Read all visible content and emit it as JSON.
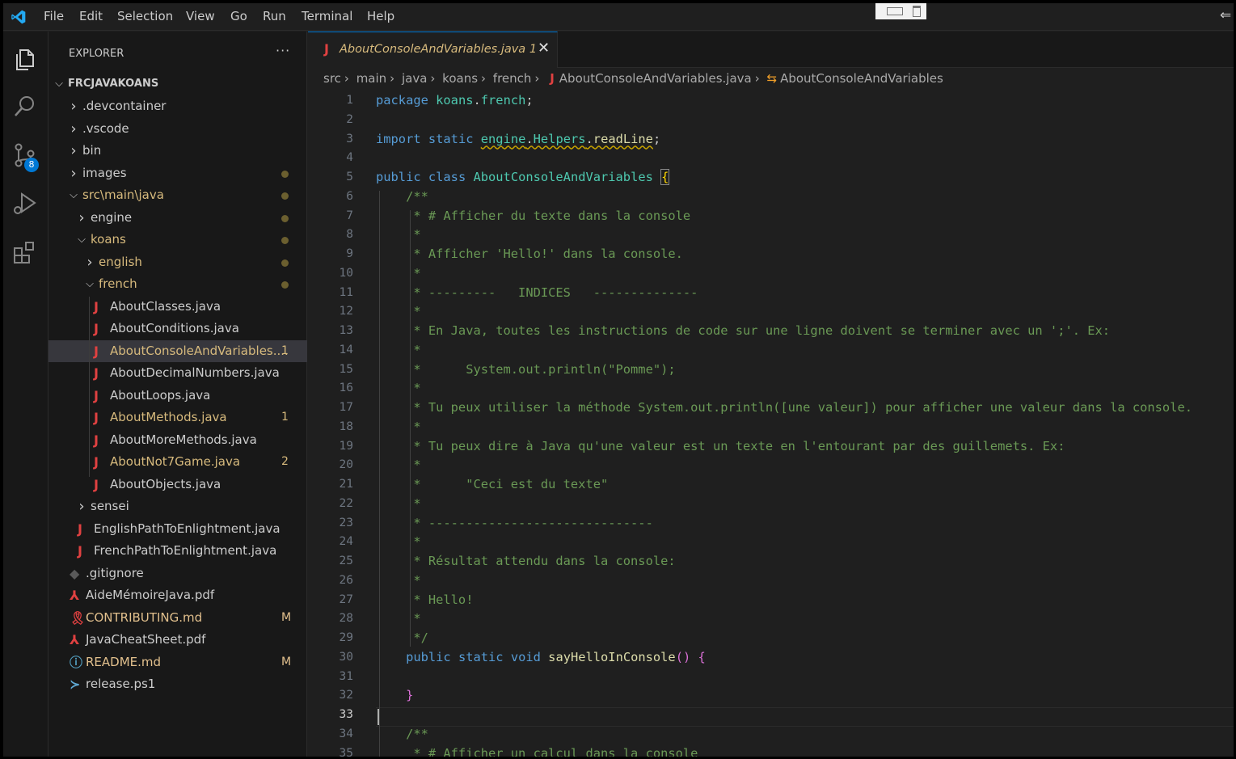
{
  "menu": [
    "File",
    "Edit",
    "Selection",
    "View",
    "Go",
    "Run",
    "Terminal",
    "Help"
  ],
  "activity_bar": {
    "icons": [
      "explorer-icon",
      "search-icon",
      "source-control-icon",
      "run-debug-icon",
      "extensions-icon"
    ],
    "source_control_badge": "8"
  },
  "explorer": {
    "title": "EXPLORER",
    "more": "···",
    "root": "FRCJAVAKOANS",
    "items": [
      {
        "name": ".devcontainer",
        "kind": "folder-collapsed",
        "depth": 1
      },
      {
        "name": ".vscode",
        "kind": "folder-collapsed",
        "depth": 1
      },
      {
        "name": "bin",
        "kind": "folder-collapsed",
        "depth": 1
      },
      {
        "name": "images",
        "kind": "folder-collapsed",
        "depth": 1,
        "dot": true
      },
      {
        "name": "src\\main\\java",
        "kind": "folder-expanded",
        "depth": 1,
        "dot": true,
        "color": "#d7ba7d"
      },
      {
        "name": "engine",
        "kind": "folder-collapsed",
        "depth": 2,
        "dot": true
      },
      {
        "name": "koans",
        "kind": "folder-expanded",
        "depth": 2,
        "dot": true,
        "color": "#d7ba7d"
      },
      {
        "name": "english",
        "kind": "folder-collapsed",
        "depth": 3,
        "dot": true,
        "color": "#d7ba7d"
      },
      {
        "name": "french",
        "kind": "folder-expanded",
        "depth": 3,
        "dot": true,
        "color": "#d7ba7d"
      },
      {
        "name": "AboutClasses.java",
        "kind": "java",
        "depth": 4
      },
      {
        "name": "AboutConditions.java",
        "kind": "java",
        "depth": 4
      },
      {
        "name": "AboutConsoleAndVariables....",
        "kind": "java",
        "depth": 4,
        "status": "1",
        "color": "#d7ba7d",
        "selected": true
      },
      {
        "name": "AboutDecimalNumbers.java",
        "kind": "java",
        "depth": 4
      },
      {
        "name": "AboutLoops.java",
        "kind": "java",
        "depth": 4
      },
      {
        "name": "AboutMethods.java",
        "kind": "java",
        "depth": 4,
        "status": "1",
        "color": "#d7ba7d"
      },
      {
        "name": "AboutMoreMethods.java",
        "kind": "java",
        "depth": 4
      },
      {
        "name": "AboutNot7Game.java",
        "kind": "java",
        "depth": 4,
        "status": "2",
        "color": "#d7ba7d"
      },
      {
        "name": "AboutObjects.java",
        "kind": "java",
        "depth": 4
      },
      {
        "name": "sensei",
        "kind": "folder-collapsed",
        "depth": 2
      },
      {
        "name": "EnglishPathToEnlightment.java",
        "kind": "java",
        "depth": 2
      },
      {
        "name": "FrenchPathToEnlightment.java",
        "kind": "java",
        "depth": 2
      },
      {
        "name": ".gitignore",
        "kind": "gitignore",
        "depth": 1
      },
      {
        "name": "AideMémoireJava.pdf",
        "kind": "pdf",
        "depth": 1
      },
      {
        "name": "CONTRIBUTING.md",
        "kind": "contrib",
        "depth": 1,
        "status": "M",
        "color": "#e2c08d"
      },
      {
        "name": "JavaCheatSheet.pdf",
        "kind": "pdf",
        "depth": 1
      },
      {
        "name": "README.md",
        "kind": "info",
        "depth": 1,
        "status": "M",
        "color": "#e2c08d"
      },
      {
        "name": "release.ps1",
        "kind": "ps",
        "depth": 1
      }
    ]
  },
  "tab": {
    "title": "AboutConsoleAndVariables.java",
    "problems": "1",
    "close": "✕"
  },
  "breadcrumb": [
    "src",
    "main",
    "java",
    "koans",
    "french",
    "AboutConsoleAndVariables.java",
    "AboutConsoleAndVariables"
  ],
  "editor": {
    "active_line": 33,
    "lines": [
      [
        [
          "kw",
          "package "
        ],
        [
          "ns",
          "koans"
        ],
        [
          "",
          "."
        ],
        [
          "ns",
          "french"
        ],
        [
          "",
          ";"
        ]
      ],
      [],
      [
        [
          "kw",
          "import "
        ],
        [
          "kw",
          "static "
        ],
        [
          "ns squig",
          "engine"
        ],
        [
          "squig",
          "."
        ],
        [
          "cls squig",
          "Helpers"
        ],
        [
          "squig",
          "."
        ],
        [
          "fn squig",
          "readLine"
        ],
        [
          "",
          ";"
        ]
      ],
      [],
      [
        [
          "kw",
          "public "
        ],
        [
          "kw",
          "class "
        ],
        [
          "cls",
          "AboutConsoleAndVariables "
        ],
        [
          "brk",
          "{"
        ]
      ],
      [
        [
          "cm",
          "    /**"
        ]
      ],
      [
        [
          "cm",
          "     * # Afficher du texte dans la console"
        ]
      ],
      [
        [
          "cm",
          "     *"
        ]
      ],
      [
        [
          "cm",
          "     * Afficher 'Hello!' dans la console."
        ]
      ],
      [
        [
          "cm",
          "     *"
        ]
      ],
      [
        [
          "cm",
          "     * ---------   INDICES   --------------"
        ]
      ],
      [
        [
          "cm",
          "     *"
        ]
      ],
      [
        [
          "cm",
          "     * En Java, toutes les instructions de code sur une ligne doivent se terminer avec un ';'. Ex:"
        ]
      ],
      [
        [
          "cm",
          "     *"
        ]
      ],
      [
        [
          "cm",
          "     *      System.out.println(\"Pomme\");"
        ]
      ],
      [
        [
          "cm",
          "     *"
        ]
      ],
      [
        [
          "cm",
          "     * Tu peux utiliser la méthode System.out.println([une valeur]) pour afficher une valeur dans la console."
        ]
      ],
      [
        [
          "cm",
          "     *"
        ]
      ],
      [
        [
          "cm",
          "     * Tu peux dire à Java qu'une valeur est un texte en l'entourant par des guillemets. Ex:"
        ]
      ],
      [
        [
          "cm",
          "     *"
        ]
      ],
      [
        [
          "cm",
          "     *      \"Ceci est du texte\""
        ]
      ],
      [
        [
          "cm",
          "     *"
        ]
      ],
      [
        [
          "cm",
          "     * ------------------------------"
        ]
      ],
      [
        [
          "cm",
          "     *"
        ]
      ],
      [
        [
          "cm",
          "     * Résultat attendu dans la console:"
        ]
      ],
      [
        [
          "cm",
          "     *"
        ]
      ],
      [
        [
          "cm",
          "     * Hello!"
        ]
      ],
      [
        [
          "cm",
          "     *"
        ]
      ],
      [
        [
          "cm",
          "     */"
        ]
      ],
      [
        [
          "",
          "    "
        ],
        [
          "kw",
          "public "
        ],
        [
          "kw",
          "static "
        ],
        [
          "kw",
          "void "
        ],
        [
          "fn",
          "sayHelloInConsole"
        ],
        [
          "brk2",
          "()"
        ],
        [
          "",
          ""
        ],
        [
          "brk2",
          " {"
        ]
      ],
      [],
      [
        [
          "brk2",
          "    }"
        ]
      ],
      [],
      [
        [
          "cm",
          "    /**"
        ]
      ],
      [
        [
          "cm",
          "     * # Afficher un calcul dans la console"
        ]
      ]
    ]
  }
}
